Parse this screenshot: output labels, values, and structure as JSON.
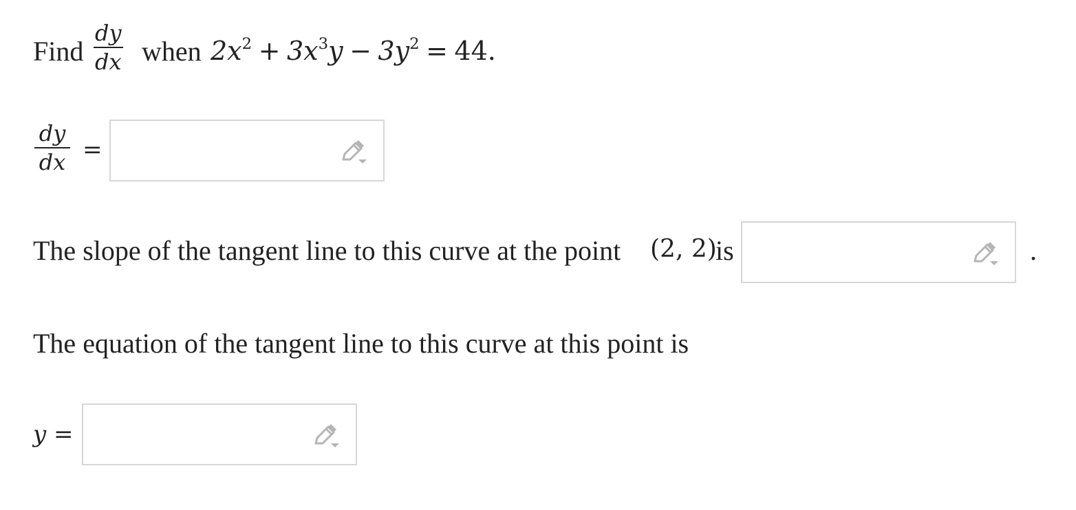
{
  "question": {
    "find_label": "Find",
    "fraction_num": "dy",
    "fraction_den": "dx",
    "when_label": "when",
    "equation": {
      "t1": "2x",
      "e1": "2",
      "op1": "+",
      "t2": "3x",
      "e2": "3",
      "t2b": "y",
      "op2": "−",
      "t3": "3y",
      "e3": "2",
      "eq": "=",
      "rhs": "44."
    }
  },
  "derivative_row": {
    "num": "dy",
    "den": "dx",
    "equals": "=",
    "input_value": ""
  },
  "slope_row": {
    "text": "The slope of the tangent line to this curve at the point",
    "point": "(2, 2)",
    "is_label": "is",
    "trailing_period": ".",
    "input_value": ""
  },
  "equation_prompt": {
    "text": "The equation of the tangent line to this curve at this point is"
  },
  "tangent_row": {
    "lhs": "y",
    "equals": "=",
    "input_value": ""
  },
  "icons": {
    "edit": "pencil-dropdown-icon",
    "color": "#b5b5b5"
  }
}
